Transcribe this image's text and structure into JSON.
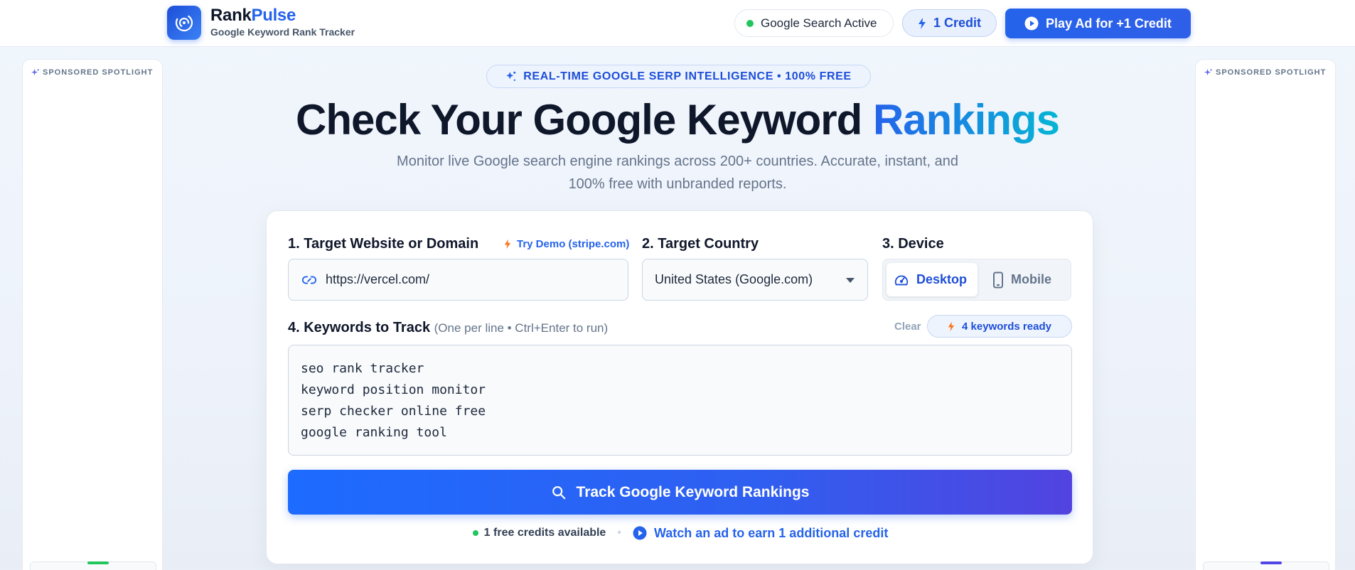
{
  "header": {
    "brand_part1": "Rank",
    "brand_part2": "Pulse",
    "brand_subtitle": "Google Keyword Rank Tracker",
    "status_label": "Google Search Active",
    "credit_label": "1 Credit",
    "play_ad_label": "Play Ad for +1 Credit"
  },
  "sidebar": {
    "left_label": "SPONSORED SPOTLIGHT",
    "right_label": "SPONSORED SPOTLIGHT"
  },
  "hero": {
    "badge": "REAL-TIME GOOGLE SERP INTELLIGENCE • 100% FREE",
    "title_main": "Check Your Google Keyword ",
    "title_accent": "Rankings",
    "subtitle": "Monitor live Google search engine rankings across 200+ countries. Accurate, instant, and 100% free with unbranded reports."
  },
  "form": {
    "website_label": "1. Target Website or Domain",
    "demo_link": "Try Demo (stripe.com)",
    "website_value": "https://vercel.com/",
    "country_label": "2. Target Country",
    "country_value": "United States (Google.com)",
    "device_label": "3. Device",
    "device_desktop": "Desktop",
    "device_mobile": "Mobile",
    "device_selected": "Desktop",
    "keywords_label": "4. Keywords to Track",
    "keywords_hint": "(One per line • Ctrl+Enter to run)",
    "clear_label": "Clear",
    "keywords_ready": "4 keywords ready",
    "keywords_value": "seo rank tracker\nkeyword position monitor\nserp checker online free\ngoogle ranking tool",
    "track_button": "Track Google Keyword Rankings",
    "credits_available": "1 free credits available",
    "watch_ad_link": "Watch an ad to earn 1 additional credit"
  },
  "colors": {
    "accent": "#2563eb",
    "status_green": "#22c55e",
    "bolt_orange": "#f97316"
  },
  "icons": [
    "logo-pulse-icon",
    "bolt-icon",
    "play-icon",
    "sparkle-icon",
    "link-icon",
    "speedometer-icon",
    "mobile-icon",
    "search-icon"
  ]
}
